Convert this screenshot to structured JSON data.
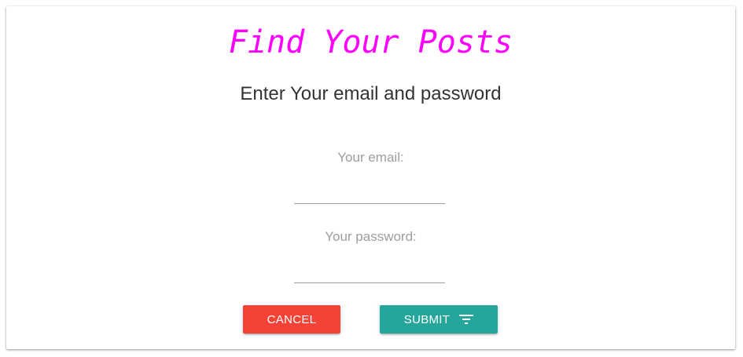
{
  "header": {
    "title": "Find Your Posts",
    "subtitle": "Enter Your email and password"
  },
  "form": {
    "email_label": "Your email:",
    "email_value": "",
    "password_label": "Your password:",
    "password_value": ""
  },
  "actions": {
    "cancel_label": "CANCEL",
    "submit_label": "SUBMIT",
    "submit_icon": "filter-list-icon"
  },
  "colors": {
    "title": "#ff00ff",
    "cancel": "#f44336",
    "submit": "#26a69a"
  }
}
